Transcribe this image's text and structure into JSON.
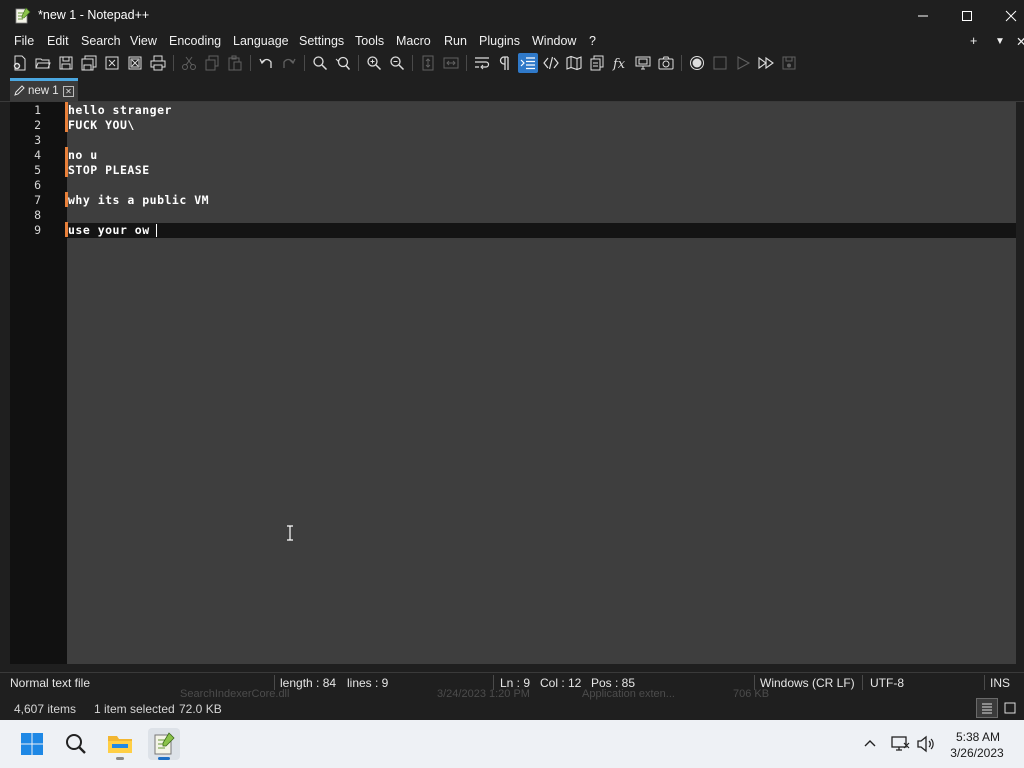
{
  "window": {
    "title": "*new 1 - Notepad++",
    "controls": {
      "minimize": "minimize-icon",
      "maximize": "maximize-icon",
      "close": "close-icon"
    }
  },
  "menu": [
    "File",
    "Edit",
    "Search",
    "View",
    "Encoding",
    "Language",
    "Settings",
    "Tools",
    "Macro",
    "Run",
    "Plugins",
    "Window",
    "?"
  ],
  "menu_right": {
    "add": "+",
    "dropdown": "▼",
    "close": "✕"
  },
  "tabs": [
    {
      "label": "new 1",
      "modified": true
    }
  ],
  "editor": {
    "line_numbers": [
      "1",
      "2",
      "3",
      "4",
      "5",
      "6",
      "7",
      "8",
      "9"
    ],
    "lines": [
      "hello stranger",
      "FUCK YOU\\",
      "",
      "no u",
      "STOP PLEASE",
      "",
      "why its a public VM",
      "",
      "use your ow"
    ],
    "current_line": 9
  },
  "status": {
    "file_type": "Normal text file",
    "length": "length : 84",
    "lines": "lines : 9",
    "ln": "Ln : 9",
    "col": "Col : 12",
    "pos": "Pos : 85",
    "eol": "Windows (CR LF)",
    "encoding": "UTF-8",
    "mode": "INS"
  },
  "explorer": {
    "items_count": "4,607 items",
    "selected": "1 item selected",
    "size": "72.0 KB",
    "ghost_row": {
      "name": "SearchIndexerCore.dll",
      "date": "3/24/2023 1:20 PM",
      "type": "Application exten...",
      "size": "706 KB"
    }
  },
  "taskbar": {
    "time": "5:38 AM",
    "date": "3/26/2023"
  },
  "colors": {
    "editor_bg": "#3e3e3e",
    "gutter_bg": "#111111",
    "change_marker": "#e8803a",
    "tab_accent": "#4ba7e0",
    "taskbar_bg": "#eef1f5"
  }
}
